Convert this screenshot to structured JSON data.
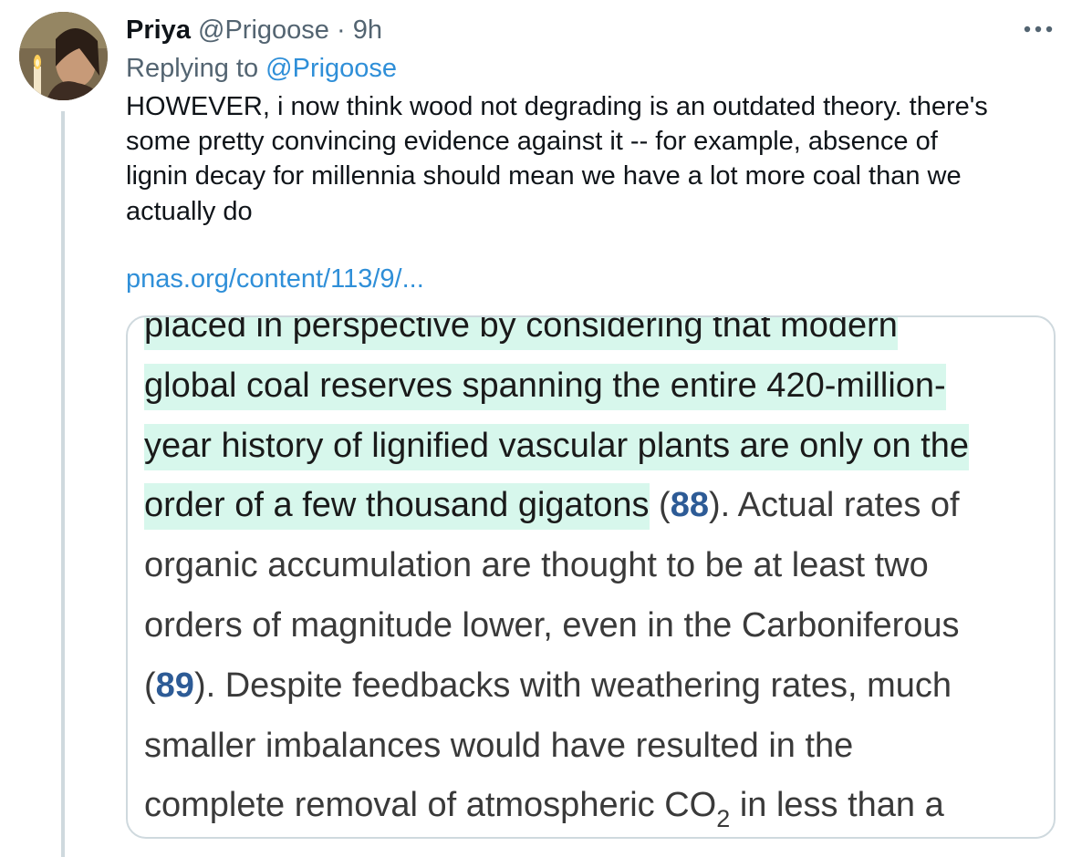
{
  "tweet": {
    "author_name": "Priya",
    "author_handle": "@Prigoose",
    "separator": "·",
    "time": "9h",
    "more_icon": "more-horizontal-icon",
    "reply_prefix": "Replying to",
    "reply_handle": "@Prigoose",
    "text_lines": [
      "HOWEVER, i now think wood not degrading is an outdated theory. there's",
      "some pretty convincing evidence against it -- for example, absence of",
      "lignin decay for millennia should mean we have a lot more coal than we",
      "actually do"
    ],
    "link": "pnas.org/content/113/9/..."
  },
  "excerpt": {
    "line1": "placed in perspective by considering that modern",
    "line2": "global coal reserves spanning the entire 420-million-",
    "line3": "year history of lignified vascular plants are only on the",
    "line4_highlight": "order of a few thousand gigatons",
    "line4_open": " (",
    "ref1": "88",
    "line4_close": "). Actual rates of",
    "line5": "organic accumulation are thought to be at least two",
    "line6": "orders of magnitude lower, even in the Carboniferous",
    "line7_open": "(",
    "ref2": "89",
    "line7_close": "). Despite feedbacks with weathering rates, much",
    "line8": "smaller imbalances would have resulted in the",
    "line9_pre": "complete removal of atmospheric CO",
    "line9_sub": "2",
    "line9_post": " in less than a"
  },
  "colors": {
    "highlight": "#d7f7ec",
    "link": "#2f8fd8",
    "reference": "#2d5b96",
    "thread_line": "#cfd9de"
  }
}
